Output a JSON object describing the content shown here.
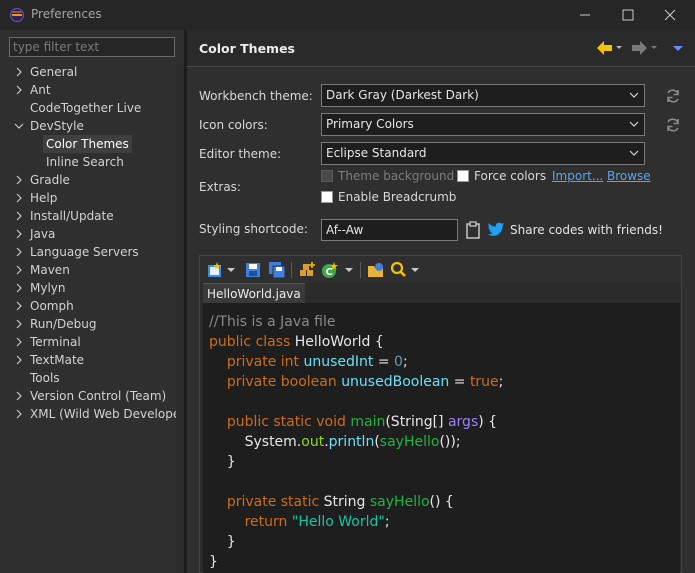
{
  "window": {
    "title": "Preferences"
  },
  "sidebar": {
    "filter_placeholder": "type filter text",
    "items": [
      {
        "label": "General",
        "expander": "collapsed"
      },
      {
        "label": "Ant",
        "expander": "collapsed"
      },
      {
        "label": "CodeTogether Live",
        "expander": "none"
      },
      {
        "label": "DevStyle",
        "expander": "expanded"
      },
      {
        "label": "Color Themes",
        "expander": "none",
        "child": true,
        "selected": true
      },
      {
        "label": "Inline Search",
        "expander": "none",
        "child": true
      },
      {
        "label": "Gradle",
        "expander": "collapsed"
      },
      {
        "label": "Help",
        "expander": "collapsed"
      },
      {
        "label": "Install/Update",
        "expander": "collapsed"
      },
      {
        "label": "Java",
        "expander": "collapsed"
      },
      {
        "label": "Language Servers",
        "expander": "collapsed"
      },
      {
        "label": "Maven",
        "expander": "collapsed"
      },
      {
        "label": "Mylyn",
        "expander": "collapsed"
      },
      {
        "label": "Oomph",
        "expander": "collapsed"
      },
      {
        "label": "Run/Debug",
        "expander": "collapsed"
      },
      {
        "label": "Terminal",
        "expander": "collapsed"
      },
      {
        "label": "TextMate",
        "expander": "collapsed"
      },
      {
        "label": "Tools",
        "expander": "none"
      },
      {
        "label": "Version Control (Team)",
        "expander": "collapsed"
      },
      {
        "label": "XML (Wild Web Developer)",
        "expander": "collapsed"
      }
    ]
  },
  "page": {
    "title": "Color Themes",
    "workbench_theme": {
      "label": "Workbench theme:",
      "value": "Dark Gray (Darkest Dark)"
    },
    "icon_colors": {
      "label": "Icon colors:",
      "value": "Primary Colors"
    },
    "editor_theme": {
      "label": "Editor theme:",
      "value": "Eclipse Standard"
    },
    "extras": {
      "label": "Extras:",
      "theme_background": {
        "label": "Theme background",
        "checked": false,
        "enabled": false
      },
      "force_colors": {
        "label": "Force colors",
        "checked": false,
        "enabled": true
      },
      "import_link": "Import...",
      "browse_link": "Browse",
      "enable_breadcrumb": {
        "label": "Enable Breadcrumb",
        "checked": false,
        "enabled": true
      }
    },
    "styling_shortcode": {
      "label": "Styling shortcode:",
      "value": "Af--Aw"
    },
    "share_text": "Share codes with friends!"
  },
  "preview": {
    "tab_label": "HelloWorld.java",
    "code_lines": [
      [
        [
          "c-comment",
          "//This is a Java file"
        ]
      ],
      [
        [
          "c-kw",
          "public class "
        ],
        [
          "c-id",
          "HelloWorld {"
        ]
      ],
      [
        [
          "c-op",
          "    "
        ],
        [
          "c-kw",
          "private int "
        ],
        [
          "c-field",
          "unusedInt"
        ],
        [
          "c-op",
          " = "
        ],
        [
          "c-num",
          "0"
        ],
        [
          "c-op",
          ";"
        ]
      ],
      [
        [
          "c-op",
          "    "
        ],
        [
          "c-kw",
          "private boolean "
        ],
        [
          "c-field",
          "unusedBoolean"
        ],
        [
          "c-op",
          " = "
        ],
        [
          "c-kw",
          "true"
        ],
        [
          "c-op",
          ";"
        ]
      ],
      [
        [
          "c-op",
          ""
        ]
      ],
      [
        [
          "c-op",
          "    "
        ],
        [
          "c-kw",
          "public static void "
        ],
        [
          "c-meth",
          "main"
        ],
        [
          "c-op",
          "(String[] "
        ],
        [
          "c-param",
          "args"
        ],
        [
          "c-op",
          ") {"
        ]
      ],
      [
        [
          "c-op",
          "        System."
        ],
        [
          "c-static",
          "out"
        ],
        [
          "c-op",
          "."
        ],
        [
          "c-field",
          "println"
        ],
        [
          "c-op",
          "("
        ],
        [
          "c-meth",
          "sayHello"
        ],
        [
          "c-op",
          "());"
        ]
      ],
      [
        [
          "c-op",
          "    }"
        ]
      ],
      [
        [
          "c-op",
          ""
        ]
      ],
      [
        [
          "c-op",
          "    "
        ],
        [
          "c-kw",
          "private static "
        ],
        [
          "c-op",
          "String "
        ],
        [
          "c-meth",
          "sayHello"
        ],
        [
          "c-op",
          "() {"
        ]
      ],
      [
        [
          "c-op",
          "        "
        ],
        [
          "c-kw",
          "return "
        ],
        [
          "c-str",
          "\"Hello World\""
        ],
        [
          "c-op",
          ";"
        ]
      ],
      [
        [
          "c-op",
          "    }"
        ]
      ],
      [
        [
          "c-op",
          "}"
        ]
      ]
    ]
  },
  "colors": {
    "accent_link": "#56a6ee",
    "nav_back_arrow": "#f5c400",
    "twitter_blue": "#1da1f2"
  }
}
